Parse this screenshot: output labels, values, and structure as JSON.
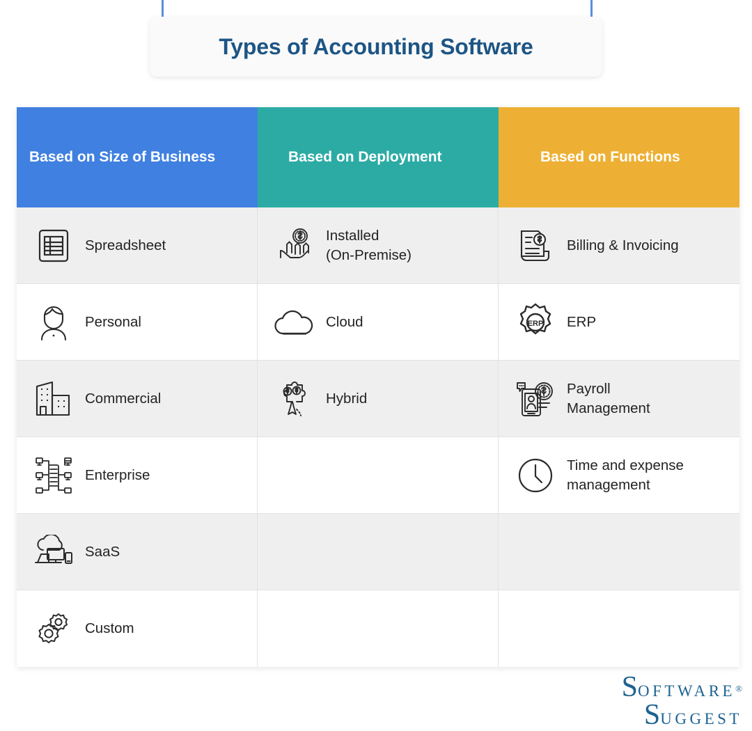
{
  "title": {
    "text": "Types of Accounting Software"
  },
  "colors": {
    "title_text": "#1D5585",
    "column_1": "#4080E0",
    "column_2": "#2CABA4",
    "column_3": "#EDB034",
    "pin_line": "#5B8FD8",
    "pin_dot": "#EDAE33",
    "row_shaded": "#EFEFEF",
    "row_plain": "#FFFFFF",
    "logo": "#1D6392"
  },
  "table": {
    "headers": [
      {
        "label": "Based on Size of Business"
      },
      {
        "label": "Based on Deployment"
      },
      {
        "label": "Based on Functions"
      }
    ],
    "rows": [
      {
        "cells": [
          {
            "label": "Spreadsheet",
            "icon": "spreadsheet-icon"
          },
          {
            "label": "Installed\n(On-Premise)",
            "icon": "hand-coins-icon"
          },
          {
            "label": "Billing & Invoicing",
            "icon": "invoice-dollar-icon"
          }
        ]
      },
      {
        "cells": [
          {
            "label": "Personal",
            "icon": "person-icon"
          },
          {
            "label": "Cloud",
            "icon": "cloud-icon"
          },
          {
            "label": "ERP",
            "icon": "gear-erp-icon"
          }
        ]
      },
      {
        "cells": [
          {
            "label": "Commercial",
            "icon": "building-icon"
          },
          {
            "label": "Hybrid",
            "icon": "puzzle-coins-icon"
          },
          {
            "label": "Payroll\nManagement",
            "icon": "payroll-mobile-icon"
          }
        ]
      },
      {
        "cells": [
          {
            "label": "Enterprise",
            "icon": "network-server-icon"
          },
          {
            "label": "",
            "icon": ""
          },
          {
            "label": "Time and expense\nmanagement",
            "icon": "clock-icon"
          }
        ]
      },
      {
        "cells": [
          {
            "label": "SaaS",
            "icon": "cloud-devices-icon"
          },
          {
            "label": "",
            "icon": ""
          },
          {
            "label": "",
            "icon": ""
          }
        ]
      },
      {
        "cells": [
          {
            "label": "Custom",
            "icon": "gears-icon"
          },
          {
            "label": "",
            "icon": ""
          },
          {
            "label": "",
            "icon": ""
          }
        ]
      }
    ]
  },
  "logo": {
    "line1_initial": "S",
    "line1_rest": "OFTWARE",
    "registered": "®",
    "line2_initial": "S",
    "line2_rest": "UGGEST"
  }
}
